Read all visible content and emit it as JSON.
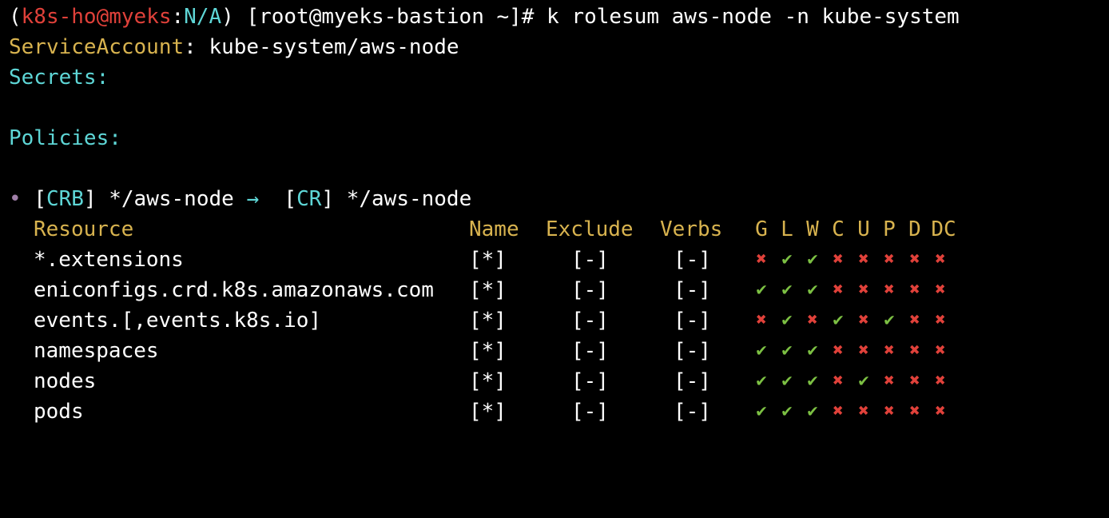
{
  "prompt": {
    "open": "(",
    "context": "k8s-ho@myeks",
    "sep": ":",
    "namespace": "N/A",
    "close": ")",
    "user_host": "[root@myeks-bastion ~]#",
    "command": "k rolesum aws-node -n kube-system"
  },
  "service_account": {
    "label": "ServiceAccount",
    "colon": ":",
    "value": "kube-system/aws-node"
  },
  "secrets": {
    "label": "Secrets:"
  },
  "policies": {
    "label": "Policies:"
  },
  "binding": {
    "bullet": "•",
    "open1": "[",
    "kind1": "CRB",
    "close1": "]",
    "name1": "*/aws-node",
    "arrow": "→",
    "open2": "[",
    "kind2": "CR",
    "close2": "]",
    "name2": "*/aws-node"
  },
  "table": {
    "headers": {
      "resource": "Resource",
      "name": "Name",
      "exclude": "Exclude",
      "verbs": "Verbs",
      "flags": [
        "G",
        "L",
        "W",
        "C",
        "U",
        "P",
        "D",
        "DC"
      ]
    },
    "rows": [
      {
        "resource": "*.extensions",
        "name": "[*]",
        "exclude": "[-]",
        "verbs": "[-]",
        "flags": [
          false,
          true,
          true,
          false,
          false,
          false,
          false,
          false
        ]
      },
      {
        "resource": "eniconfigs.crd.k8s.amazonaws.com",
        "name": "[*]",
        "exclude": "[-]",
        "verbs": "[-]",
        "flags": [
          true,
          true,
          true,
          false,
          false,
          false,
          false,
          false
        ]
      },
      {
        "resource": "events.[,events.k8s.io]",
        "name": "[*]",
        "exclude": "[-]",
        "verbs": "[-]",
        "flags": [
          false,
          true,
          false,
          true,
          false,
          true,
          false,
          false
        ]
      },
      {
        "resource": "namespaces",
        "name": "[*]",
        "exclude": "[-]",
        "verbs": "[-]",
        "flags": [
          true,
          true,
          true,
          false,
          false,
          false,
          false,
          false
        ]
      },
      {
        "resource": "nodes",
        "name": "[*]",
        "exclude": "[-]",
        "verbs": "[-]",
        "flags": [
          true,
          true,
          true,
          false,
          true,
          false,
          false,
          false
        ]
      },
      {
        "resource": "pods",
        "name": "[*]",
        "exclude": "[-]",
        "verbs": "[-]",
        "flags": [
          true,
          true,
          true,
          false,
          false,
          false,
          false,
          false
        ]
      }
    ],
    "check_glyph": "✔",
    "cross_glyph": "✖"
  },
  "colors": {
    "background": "#000000",
    "text": "#ffffff",
    "context": "#e0413a",
    "cyan": "#5ed6d6",
    "yellow": "#d8b34f",
    "check": "#7cc043",
    "cross": "#e0413a"
  }
}
